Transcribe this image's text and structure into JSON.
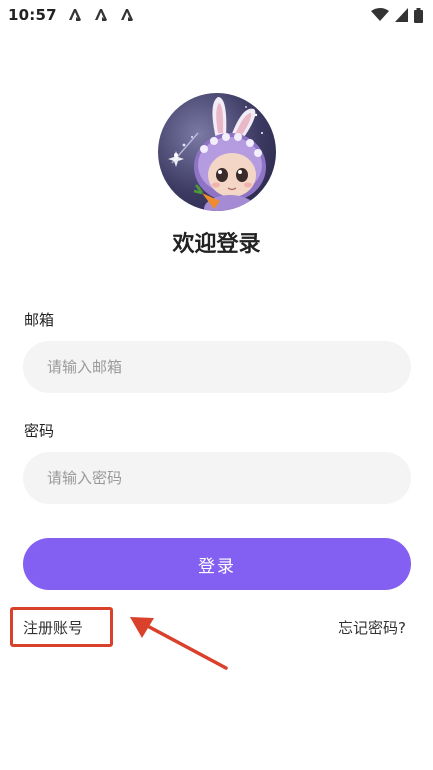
{
  "status_bar": {
    "time": "10:57",
    "notification_icons": [
      "app-notification-icon",
      "app-notification-icon",
      "app-notification-icon"
    ],
    "right_icons": [
      "wifi-icon",
      "signal-icon",
      "battery-icon"
    ]
  },
  "login": {
    "title": "欢迎登录",
    "email_label": "邮箱",
    "email_placeholder": "请输入邮箱",
    "password_label": "密码",
    "password_placeholder": "请输入密码",
    "login_button": "登录",
    "register_link": "注册账号",
    "forgot_link": "忘记密码?"
  },
  "colors": {
    "primary": "#8460f2",
    "annotation": "#d9412b",
    "input_bg": "#f4f4f4"
  }
}
